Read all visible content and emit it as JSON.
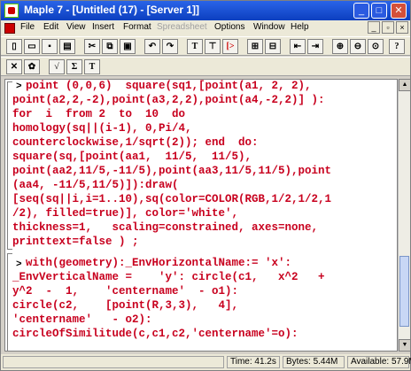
{
  "window": {
    "title": "Maple 7 - [Untitled (17) - [Server 1]]"
  },
  "menu": {
    "items": [
      "File",
      "Edit",
      "View",
      "Insert",
      "Format",
      "Spreadsheet",
      "Options",
      "Window",
      "Help"
    ]
  },
  "toolbar": {
    "text_T_label": "T",
    "text_sigma_label": "Σ"
  },
  "document": {
    "prompts": [
      ">",
      ">"
    ],
    "lines": [
      "  point (0,0,6)  square(sq1,[point(a1, 2, 2),",
      "point(a2,2,-2),point(a3,2,2),point(a4,-2,2)] ):",
      "for  i  from 2  to  10  do",
      "homology(sq||(i-1), 0,Pi/4,",
      "counterclockwise,1/sqrt(2)); end  do:",
      "square(sq,[point(aa1,  11/5,  11/5),",
      "point(aa2,11/5,-11/5),point(aa3,11/5,11/5),point",
      "(aa4, -11/5,11/5)]):draw(",
      "[seq(sq||i,i=1..10),sq(color=COLOR(RGB,1/2,1/2,1",
      "/2), filled=true)], color='white',",
      "thickness=1,   scaling=constrained, axes=none,",
      "printtext=false ) ;",
      "  with(geometry):_EnvHorizontalName:= 'x':",
      "_EnvVerticalName =    'y': circle(c1,   x^2   +",
      "y^2  -  1,    'centername'  - o1):",
      "circle(c2,    [point(R,3,3),   4],",
      "'centername'   - o2):",
      "circleOfSimilitude(c,c1,c2,'centername'=o):"
    ]
  },
  "status": {
    "time": "Time: 41.2s",
    "bytes": "Bytes: 5.44M",
    "available": "Available: 57.9M"
  }
}
